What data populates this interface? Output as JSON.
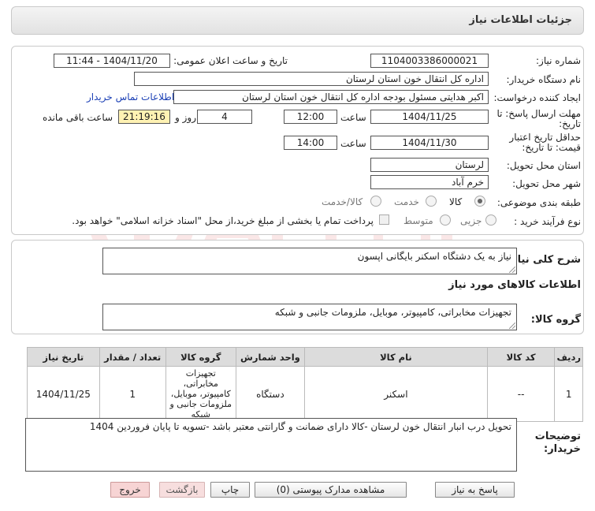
{
  "header": {
    "title": "جزئیات اطلاعات نیاز"
  },
  "form": {
    "need_number_label": "شماره نیاز:",
    "need_number": "1104003386000021",
    "announce_label": "تاریخ و ساعت اعلان عمومی:",
    "announce_value": "1404/11/20 - 11:44",
    "buyer_org_label": "نام دستگاه خریدار:",
    "buyer_org": "اداره کل انتقال خون استان لرستان",
    "requester_label": "ایجاد کننده درخواست:",
    "requester": "اکبر هدایتی مسئول بودجه اداره کل انتقال خون استان لرستان",
    "contact_link": "اطلاعات تماس خریدار",
    "deadline_label_1": "مهلت ارسال پاسخ: تا",
    "deadline_label_2": "تاریخ:",
    "deadline_date": "1404/11/25",
    "time_label": "ساعت",
    "deadline_time": "12:00",
    "days_value": "4",
    "days_label": "روز و",
    "remaining_time": "21:19:16",
    "remaining_label": "ساعت باقی مانده",
    "validity_label_1": "حداقل تاریخ اعتبار",
    "validity_label_2": "قیمت: تا تاریخ:",
    "validity_date": "1404/11/30",
    "validity_time": "14:00",
    "province_label": "استان محل تحویل:",
    "province": "لرستان",
    "city_label": "شهر محل تحویل:",
    "city": "خرم آباد",
    "category_label": "طبقه بندی موضوعی:",
    "category_options": [
      "کالا",
      "خدمت",
      "کالا/خدمت"
    ],
    "process_label": "نوع فرآیند خرید :",
    "process_options": [
      "جزیی",
      "متوسط"
    ],
    "payment_note": "پرداخت تمام یا بخشی از مبلغ خرید،از محل \"اسناد خزانه اسلامی\" خواهد بود."
  },
  "description": {
    "label": "شرح کلی نیاز:",
    "value": "نیاز به یک دشتگاه اسکنر بایگانی اپسون"
  },
  "goods_info": {
    "title": "اطلاعات کالاهای مورد نیاز",
    "group_label": "گروه کالا:",
    "group_value": "تجهیزات مخابراتی، کامپیوتر، موبایل، ملزومات جانبی و شبکه"
  },
  "table": {
    "headers": [
      "ردیف",
      "کد کالا",
      "نام کالا",
      "واحد شمارش",
      "گروه کالا",
      "تعداد / مقدار",
      "تاریخ نیاز"
    ],
    "rows": [
      [
        "1",
        "--",
        "اسکنر",
        "دستگاه",
        "تجهیزات مخابراتی، کامپیوتر، موبایل، ملزومات جانبی و شبکه",
        "1",
        "1404/11/25"
      ]
    ]
  },
  "buyer_notes": {
    "label_1": "توضیحات",
    "label_2": "خریدار:",
    "value": "تحویل درب انبار انتقال خون لرستان -کالا دارای ضمانت و گارانتی معتبر باشد -تسویه تا پایان فروردین 1404"
  },
  "buttons": {
    "reply": "پاسخ به نیاز",
    "attachments": "مشاهده مدارک پیوستی (0)",
    "print": "چاپ",
    "back": "بازگشت",
    "exit": "خروج"
  }
}
